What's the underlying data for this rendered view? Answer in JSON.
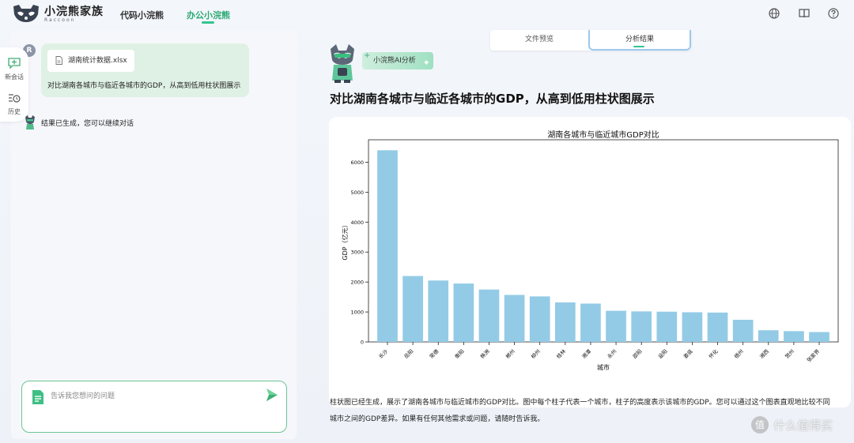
{
  "header": {
    "brand_name": "小浣熊家族",
    "brand_sub": "Raccoon",
    "nav": [
      {
        "label": "代码小浣熊",
        "active": false
      },
      {
        "label": "办公小浣熊",
        "active": true
      }
    ],
    "accent_color": "#34c38f"
  },
  "sidebar": {
    "items": [
      {
        "label": "新会话",
        "icon": "new-chat-icon"
      },
      {
        "label": "历史",
        "icon": "history-icon"
      }
    ]
  },
  "chat": {
    "user_avatar_letter": "R",
    "file_name": "湖南统计数据.xlsx",
    "user_message": "对比湖南各城市与临近各城市的GDP，从高到低用柱状图展示",
    "bot_message": "结果已生成，您可以继续对话",
    "input_placeholder": "告诉我您想问的问题"
  },
  "main": {
    "tabs": [
      {
        "label": "文件预览",
        "active": false
      },
      {
        "label": "分析结果",
        "active": true
      }
    ],
    "ai_badge": "小浣熊AI分析",
    "heading": "对比湖南各城市与临近各城市的GDP，从高到低用柱状图展示",
    "description": "柱状图已经生成，展示了湖南各城市与临近城市的GDP对比。图中每个柱子代表一个城市，柱子的高度表示该城市的GDP。您可以通过这个图表直观地比较不同城市之间的GDP差异。如果有任何其他需求或问题，请随时告诉我。"
  },
  "watermark": {
    "circle": "值",
    "text": "什么值得买"
  },
  "chart_data": {
    "type": "bar",
    "title": "湖南各城市与临近城市GDP对比",
    "xlabel": "城市",
    "ylabel": "GDP（亿元）",
    "categories": [
      "长沙",
      "岳阳",
      "常德",
      "衡阳",
      "株洲",
      "郴州",
      "柳州",
      "桂林",
      "湘潭",
      "永州",
      "邵阳",
      "益阳",
      "娄底",
      "怀化",
      "梧州",
      "湘西",
      "贺州",
      "张家界"
    ],
    "values": [
      6400,
      2200,
      2050,
      1950,
      1750,
      1570,
      1520,
      1320,
      1280,
      1040,
      1020,
      1010,
      990,
      980,
      740,
      390,
      360,
      330
    ],
    "ylim": [
      0,
      6750
    ],
    "yticks": [
      0,
      1000,
      2000,
      3000,
      4000,
      5000,
      6000
    ],
    "bar_color": "#93cbe6",
    "grid": false,
    "legend": "none"
  }
}
